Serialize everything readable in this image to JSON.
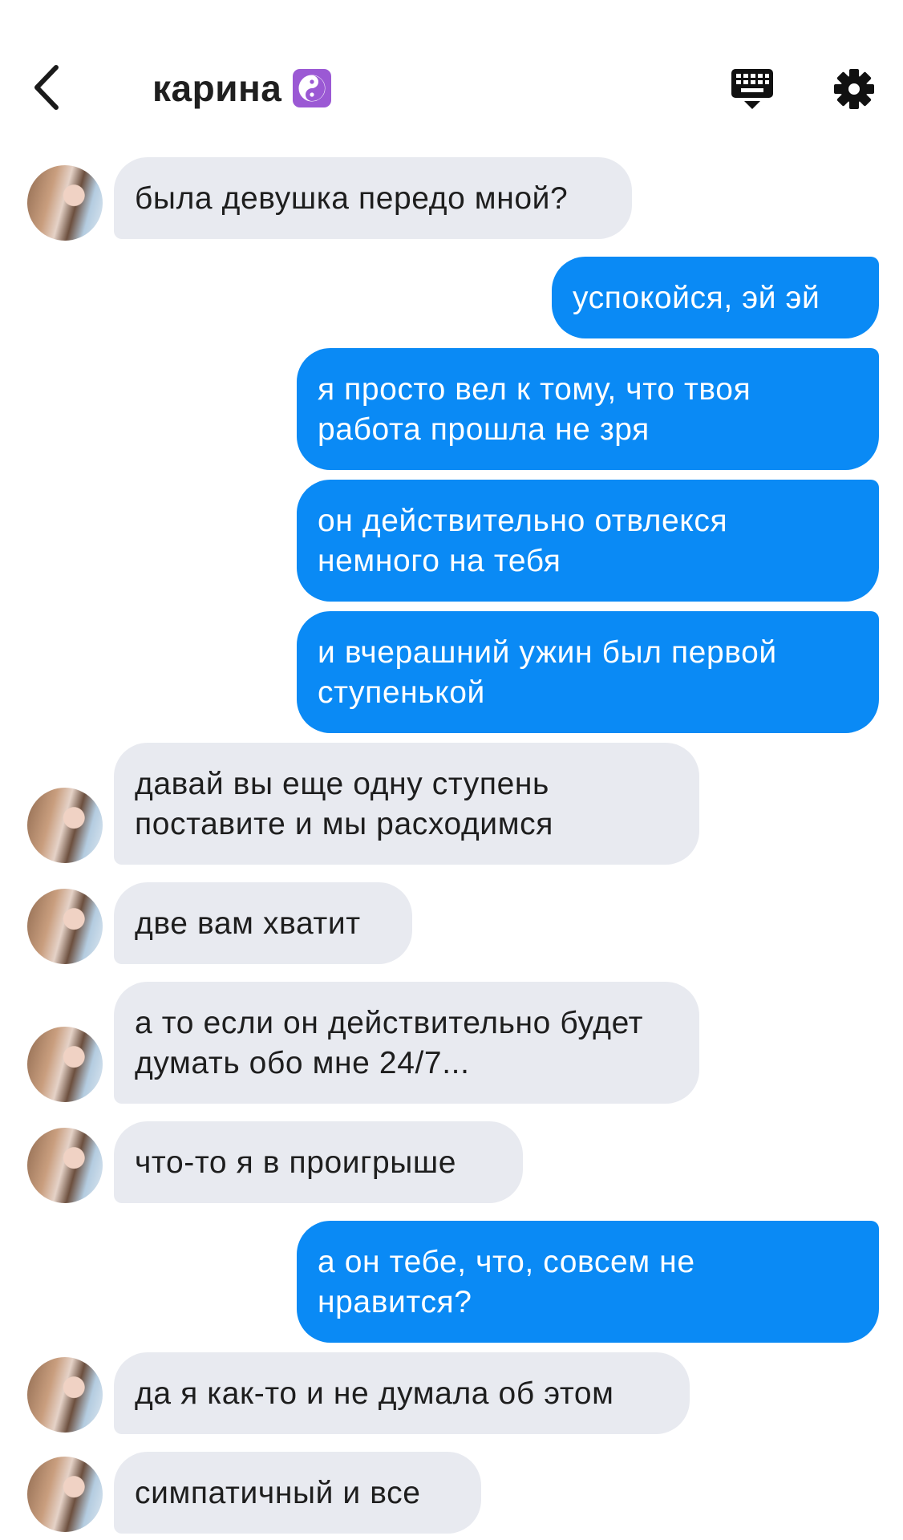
{
  "header": {
    "title": "карина",
    "title_emoji": "yin-yang-emoji",
    "back_icon": "chevron-left-icon",
    "keyboard_icon": "keyboard-icon",
    "settings_icon": "gear-icon"
  },
  "colors": {
    "incoming_bubble": "#e8eaf0",
    "outgoing_bubble": "#0a8af5",
    "emoji_background": "#9b59d4"
  },
  "messages": [
    {
      "dir": "in",
      "avatar": true,
      "text": "была девушка передо мной?"
    },
    {
      "dir": "out",
      "text": "успокойся, эй эй"
    },
    {
      "dir": "out",
      "text": "я просто вел к тому, что твоя работа прошла не зря"
    },
    {
      "dir": "out",
      "text": "он действительно отвлекся немного на тебя"
    },
    {
      "dir": "out",
      "text": "и вчерашний ужин был первой ступенькой"
    },
    {
      "dir": "in",
      "avatar": true,
      "text": "давай вы еще одну ступень поставите и мы расходимся"
    },
    {
      "dir": "in",
      "avatar": true,
      "text": "две вам хватит"
    },
    {
      "dir": "in",
      "avatar": true,
      "text": "а то если он действительно будет думать обо мне 24/7..."
    },
    {
      "dir": "in",
      "avatar": true,
      "text": "что-то я в проигрыше"
    },
    {
      "dir": "out",
      "text": "а он тебе, что, совсем не нравится?"
    },
    {
      "dir": "in",
      "avatar": true,
      "text": "да я как-то и не думала об этом"
    },
    {
      "dir": "in",
      "avatar": true,
      "text": "симпатичный и все"
    }
  ]
}
